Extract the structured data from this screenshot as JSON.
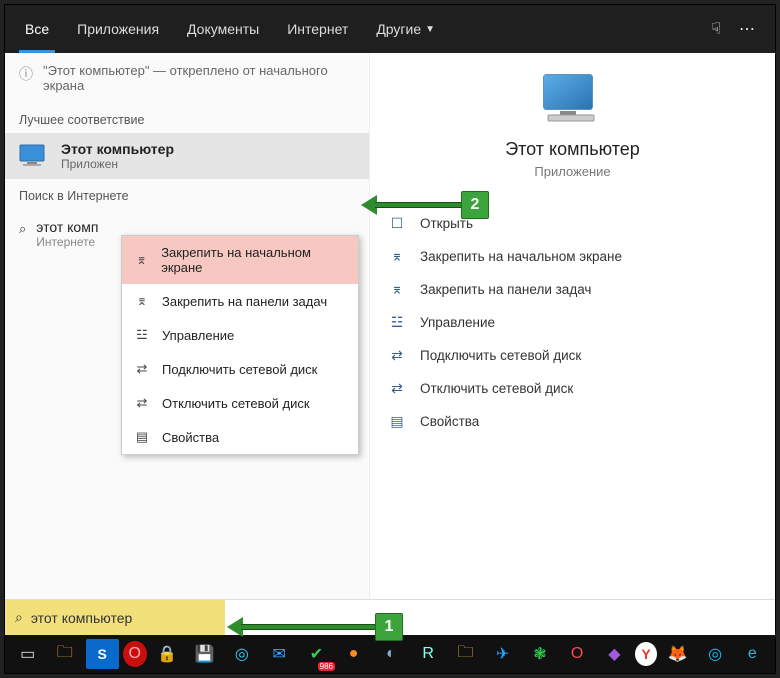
{
  "tabs": {
    "items": [
      "Все",
      "Приложения",
      "Документы",
      "Интернет",
      "Другие"
    ],
    "active_index": 0
  },
  "pin_message": "\"Этот компьютер\" — откреплено от начального экрана",
  "sections": {
    "best_match": "Лучшее соответствие",
    "web_search": "Поиск в Интернете"
  },
  "best_match": {
    "title": "Этот компьютер",
    "subtitle": "Приложен"
  },
  "web_item": {
    "title": "этот комп",
    "subtitle": "Интернете"
  },
  "context_menu": {
    "items": [
      {
        "icon": "⌆",
        "label": "Закрепить на начальном экране",
        "hover": true
      },
      {
        "icon": "⌆",
        "label": "Закрепить на панели задач"
      },
      {
        "icon": "☳",
        "label": "Управление"
      },
      {
        "icon": "⇄",
        "label": "Подключить сетевой диск"
      },
      {
        "icon": "⇄",
        "label": "Отключить сетевой диск"
      },
      {
        "icon": "▤",
        "label": "Свойства"
      }
    ]
  },
  "preview": {
    "title": "Этот компьютер",
    "subtitle": "Приложение",
    "actions": [
      {
        "icon": "☐",
        "label": "Открыть"
      },
      {
        "icon": "⌆",
        "label": "Закрепить на начальном экране"
      },
      {
        "icon": "⌆",
        "label": "Закрепить на панели задач"
      },
      {
        "icon": "☳",
        "label": "Управление"
      },
      {
        "icon": "⇄",
        "label": "Подключить сетевой диск"
      },
      {
        "icon": "⇄",
        "label": "Отключить сетевой диск"
      },
      {
        "icon": "▤",
        "label": "Свойства"
      }
    ]
  },
  "callouts": {
    "num1": "1",
    "num2": "2"
  },
  "search": {
    "query": "этот компьютер"
  },
  "taskbar": {
    "icons": [
      {
        "name": "taskview",
        "glyph": "▭",
        "cls": ""
      },
      {
        "name": "explorer",
        "glyph": "🗀",
        "cls": "yellow"
      },
      {
        "name": "snagit",
        "glyph": "S",
        "cls": "snagit"
      },
      {
        "name": "opera",
        "glyph": "O",
        "cls": "opera"
      },
      {
        "name": "lock",
        "glyph": "🔒",
        "cls": "word"
      },
      {
        "name": "save",
        "glyph": "💾",
        "cls": "floppy"
      },
      {
        "name": "app1",
        "glyph": "◎",
        "cls": "blue1"
      },
      {
        "name": "comment",
        "glyph": "✉",
        "cls": "blue2"
      },
      {
        "name": "torrent",
        "glyph": "✔",
        "cls": "green badge986"
      },
      {
        "name": "firefox",
        "glyph": "●",
        "cls": "ff"
      },
      {
        "name": "steam",
        "glyph": "◐",
        "cls": "steam"
      },
      {
        "name": "r",
        "glyph": "R",
        "cls": "box"
      },
      {
        "name": "folder2",
        "glyph": "🗀",
        "cls": "yellow"
      },
      {
        "name": "tg",
        "glyph": "✈",
        "cls": "blue3"
      },
      {
        "name": "app2",
        "glyph": "❃",
        "cls": "green"
      },
      {
        "name": "opera2",
        "glyph": "O",
        "cls": "opera2"
      },
      {
        "name": "app3",
        "glyph": "◆",
        "cls": "purple"
      },
      {
        "name": "yandex",
        "glyph": "Y",
        "cls": "yandex"
      },
      {
        "name": "firefox2",
        "glyph": "🦊",
        "cls": "ff2"
      },
      {
        "name": "app4",
        "glyph": "◎",
        "cls": "teal"
      },
      {
        "name": "edge",
        "glyph": "e",
        "cls": "edge"
      }
    ]
  }
}
